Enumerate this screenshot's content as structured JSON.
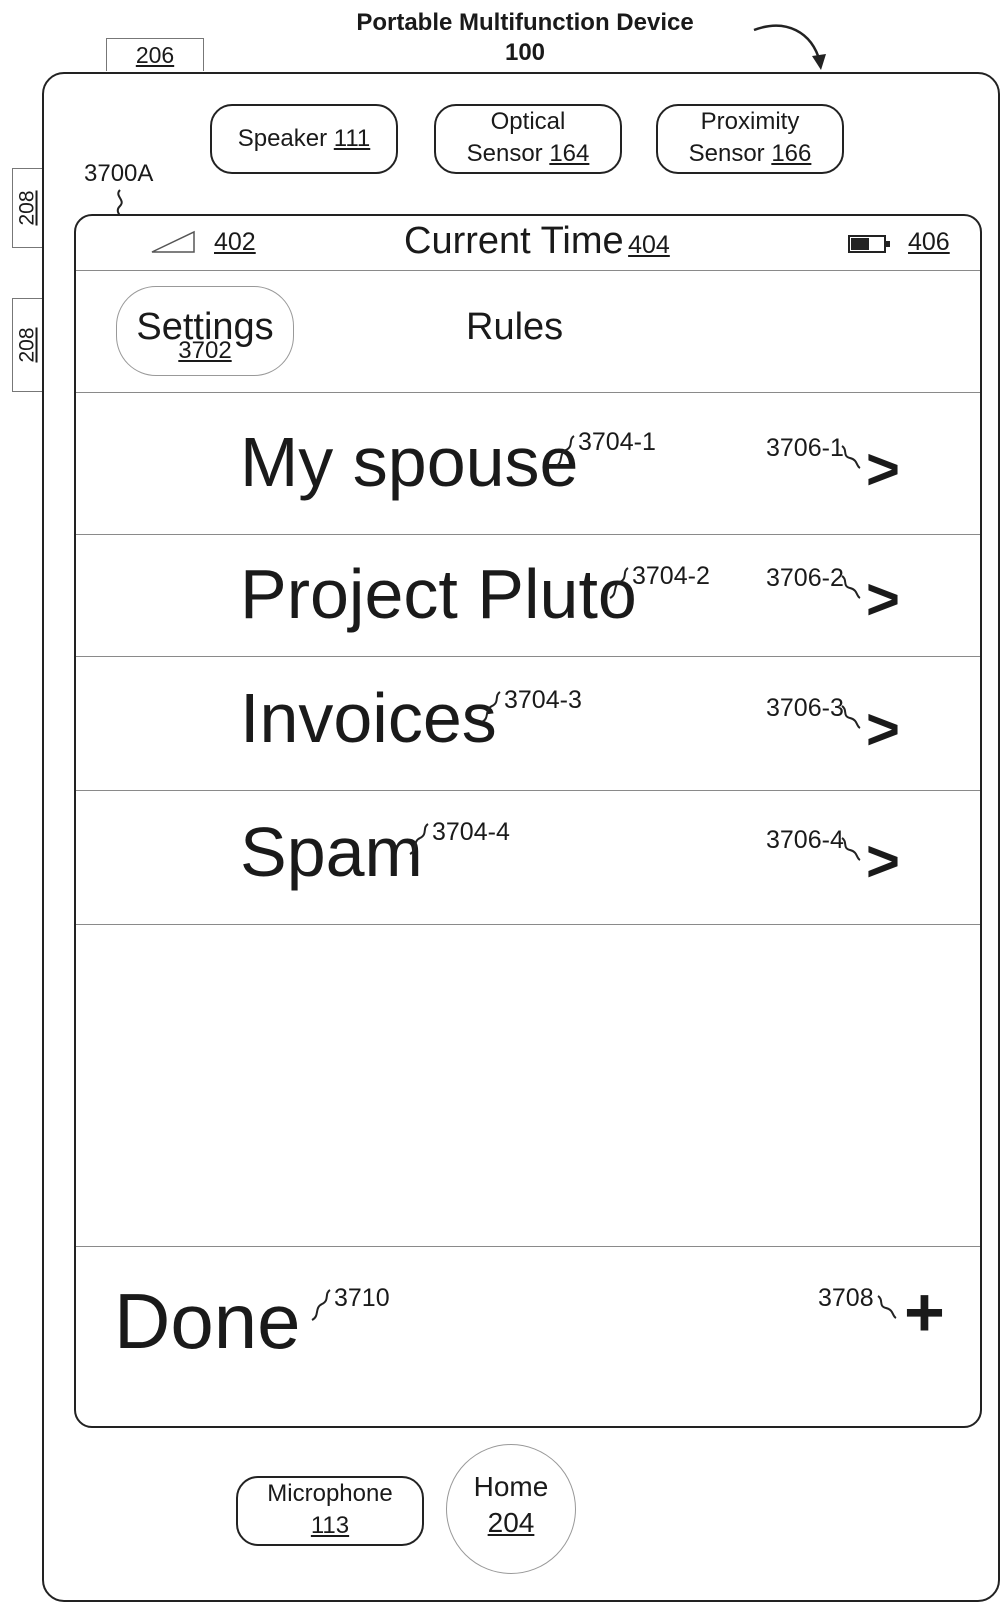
{
  "header": {
    "title_line1": "Portable Multifunction Device",
    "title_line2": "100"
  },
  "frame_refs": {
    "tab_top": "206",
    "tab_side_1": "208",
    "tab_side_2": "208",
    "screen_ref": "3700A"
  },
  "hardware": {
    "speaker": {
      "label": "Speaker",
      "ref": "111"
    },
    "optical_sensor": {
      "line1": "Optical",
      "line2": "Sensor",
      "ref": "164"
    },
    "proximity_sensor": {
      "line1": "Proximity",
      "line2": "Sensor",
      "ref": "166"
    },
    "microphone": {
      "label": "Microphone",
      "ref": "113"
    },
    "home": {
      "label": "Home",
      "ref": "204"
    }
  },
  "status_bar": {
    "signal_ref": "402",
    "time_label": "Current Time",
    "time_ref": "404",
    "battery_ref": "406"
  },
  "nav_bar": {
    "back_label": "Settings",
    "back_ref": "3702",
    "title": "Rules"
  },
  "rules": [
    {
      "label": "My spouse",
      "ref": "3704-1",
      "chevron_ref": "3706-1",
      "chevron": ">"
    },
    {
      "label": "Project Pluto",
      "ref": "3704-2",
      "chevron_ref": "3706-2",
      "chevron": ">"
    },
    {
      "label": "Invoices",
      "ref": "3704-3",
      "chevron_ref": "3706-3",
      "chevron": ">"
    },
    {
      "label": "Spam",
      "ref": "3704-4",
      "chevron_ref": "3706-4",
      "chevron": ">"
    }
  ],
  "toolbar": {
    "done_label": "Done",
    "done_ref": "3710",
    "add_ref": "3708",
    "add_symbol": "+"
  },
  "icons": [
    "signal-icon",
    "battery-icon",
    "chevron-right-icon",
    "plus-icon",
    "curved-arrow-icon"
  ]
}
